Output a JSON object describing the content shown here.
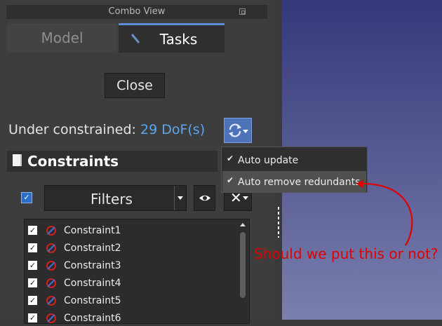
{
  "panel": {
    "title": "Combo View",
    "tabs": [
      {
        "label": "Model",
        "active": false
      },
      {
        "label": "Tasks",
        "active": true
      }
    ],
    "close_label": "Close",
    "status_prefix": "Under constrained: ",
    "status_dof": "29 DoF(s)",
    "constraints_title": "Constraints",
    "filters_label": "Filters",
    "constraints": [
      "Constraint1",
      "Constraint2",
      "Constraint3",
      "Constraint4",
      "Constraint5",
      "Constraint6"
    ]
  },
  "menu": {
    "items": [
      {
        "label": "Auto update",
        "checked": true
      },
      {
        "label": "Auto remove redundants",
        "checked": true
      }
    ]
  },
  "annotation": {
    "text": "Should we put this or not?",
    "color": "#e00000"
  },
  "colors": {
    "accent": "#4e73b8",
    "dof": "#5aa6f0",
    "viewport_top": "#353879",
    "viewport_bottom": "#7a7fae"
  }
}
